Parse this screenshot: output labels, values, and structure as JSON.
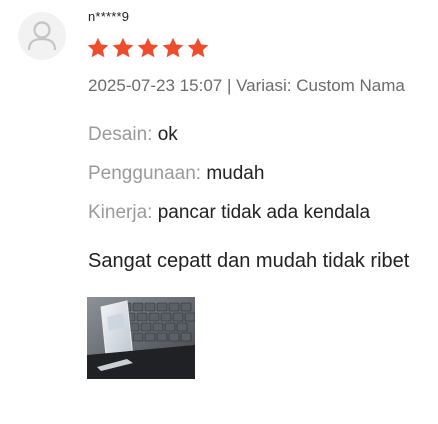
{
  "review": {
    "username": "n*****9",
    "rating": 5,
    "star_color": "#ee4d2d",
    "meta": "2025-07-23 15:07 | Variasi: Custom Nama",
    "attributes": [
      {
        "key": "Desain:",
        "value": "ok"
      },
      {
        "key": "Penggunaan:",
        "value": "mudah"
      },
      {
        "key": "Kinerja:",
        "value": "pancar tidak ada kendala"
      }
    ],
    "comment": "Sangat cepatt dan mudah tidak ribet",
    "avatar_icon": "user-icon",
    "photo_count": 1
  }
}
